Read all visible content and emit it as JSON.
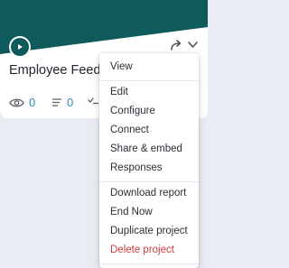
{
  "colors": {
    "banner": "#0f5a5a",
    "stat_text": "#2a8fbf",
    "danger": "#cc3a3a",
    "page_background": "#e9ecf3"
  },
  "card": {
    "title": "Employee Feedl",
    "play_icon": "play-icon",
    "share_icon": "share-icon",
    "chevron_icon": "chevron-down-icon",
    "stats": {
      "views": {
        "icon": "eye-icon",
        "value": "0"
      },
      "responses": {
        "icon": "list-icon",
        "value": "0"
      },
      "completed": {
        "icon": "check-list-icon"
      }
    }
  },
  "menu": {
    "items": [
      {
        "label": "View"
      },
      {
        "label": "Edit"
      },
      {
        "label": "Configure"
      },
      {
        "label": "Connect"
      },
      {
        "label": "Share & embed"
      },
      {
        "label": "Responses"
      },
      {
        "label": "Download report"
      },
      {
        "label": "End Now"
      },
      {
        "label": "Duplicate project"
      },
      {
        "label": "Delete project"
      }
    ]
  }
}
